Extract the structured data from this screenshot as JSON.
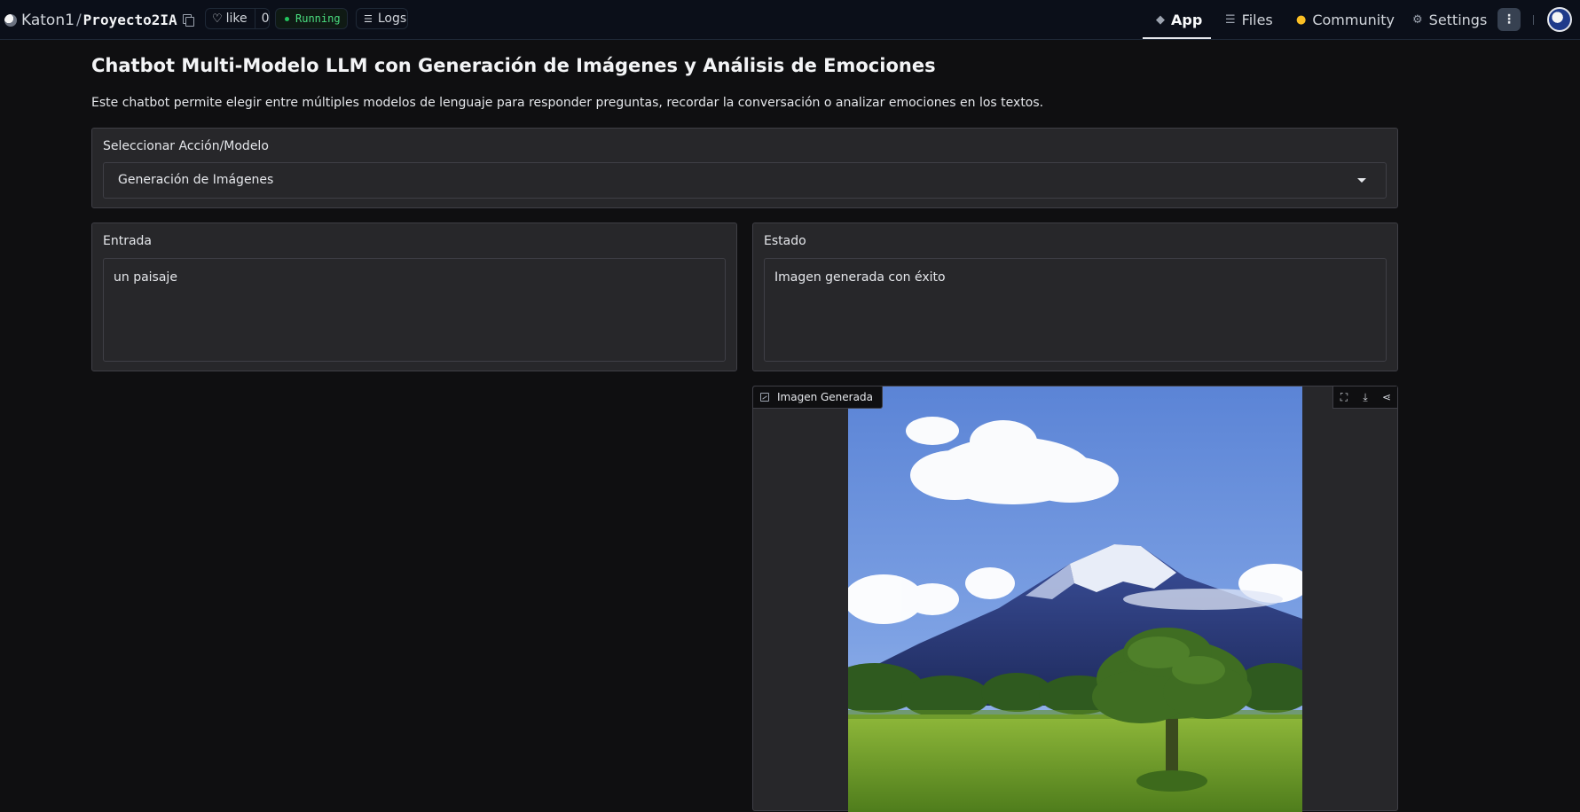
{
  "header": {
    "owner": "Katon1",
    "separator": "/",
    "repo": "Proyecto2IA",
    "like_label": "like",
    "like_count": "0",
    "status": "Running",
    "logs_label": "Logs",
    "nav": {
      "app": "App",
      "files": "Files",
      "community": "Community",
      "settings": "Settings"
    }
  },
  "main": {
    "title": "Chatbot Multi-Modelo LLM con Generación de Imágenes y Análisis de Emociones",
    "description": "Este chatbot permite elegir entre múltiples modelos de lenguaje para responder preguntas, recordar la conversación o analizar emociones en los textos.",
    "selector": {
      "label": "Seleccionar Acción/Modelo",
      "value": "Generación de Imágenes"
    },
    "input": {
      "label": "Entrada",
      "value": "un paisaje"
    },
    "status": {
      "label": "Estado",
      "value": "Imagen generada con éxito"
    },
    "image": {
      "label": "Imagen Generada"
    }
  },
  "colors": {
    "background": "#0f0f11",
    "panel": "#27272a",
    "border": "#3f3f46",
    "running": "#22c55e"
  }
}
